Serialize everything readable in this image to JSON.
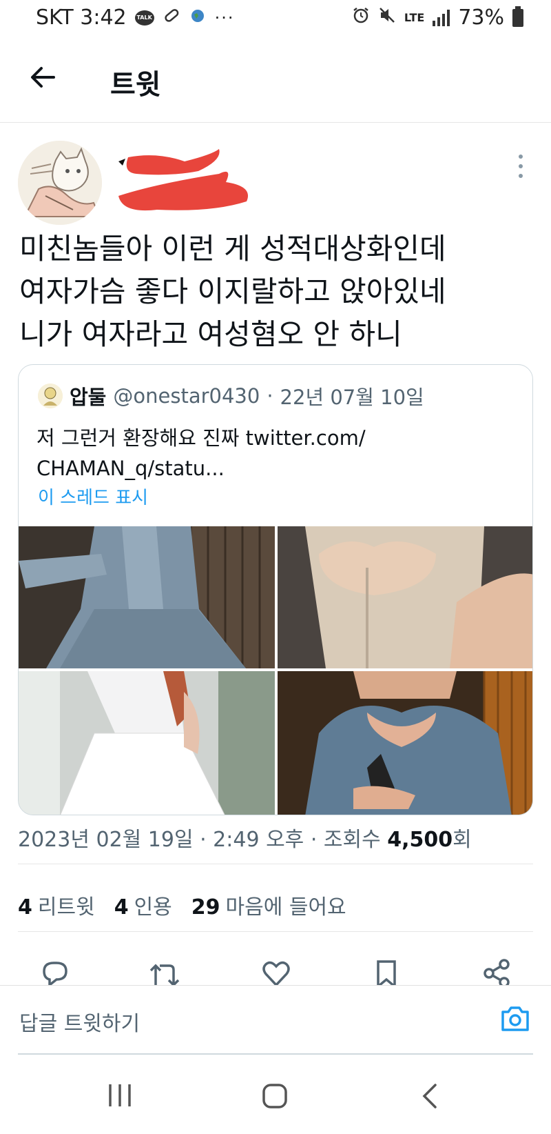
{
  "status_bar": {
    "carrier_time": "SKT 3:42",
    "talk_label": "TALK",
    "more": "···",
    "network": "LTE",
    "battery_percent": "73%"
  },
  "header": {
    "title": "트윗"
  },
  "tweet": {
    "text": "미친놈들아 이런 게 성적대상화인데\n여자가슴 좋다 이지랄하고 앉아있네\n니가 여자라고 여성혐오 안 하니",
    "date": "2023년 02월 19일 · 2:49 오후 · 조회수 ",
    "views": "4,500",
    "views_suffix": "회"
  },
  "quote": {
    "name": "압둘",
    "handle": "@onestar0430",
    "dot": "·",
    "date": "22년 07월 10일",
    "body": "저 그런거 환장해요 진짜 twitter.com/\nCHAMAN_q/statu...",
    "thread_link": "이 스레드 표시"
  },
  "stats": {
    "retweets_count": "4",
    "retweets_label": "리트윗",
    "quotes_count": "4",
    "quotes_label": "인용",
    "likes_count": "29",
    "likes_label": "마음에 들어요"
  },
  "reply": {
    "placeholder": "답글 트윗하기"
  },
  "colors": {
    "accent": "#1d9bf0",
    "text": "#0f1419",
    "muted": "#536471",
    "redaction": "#e8453c"
  }
}
